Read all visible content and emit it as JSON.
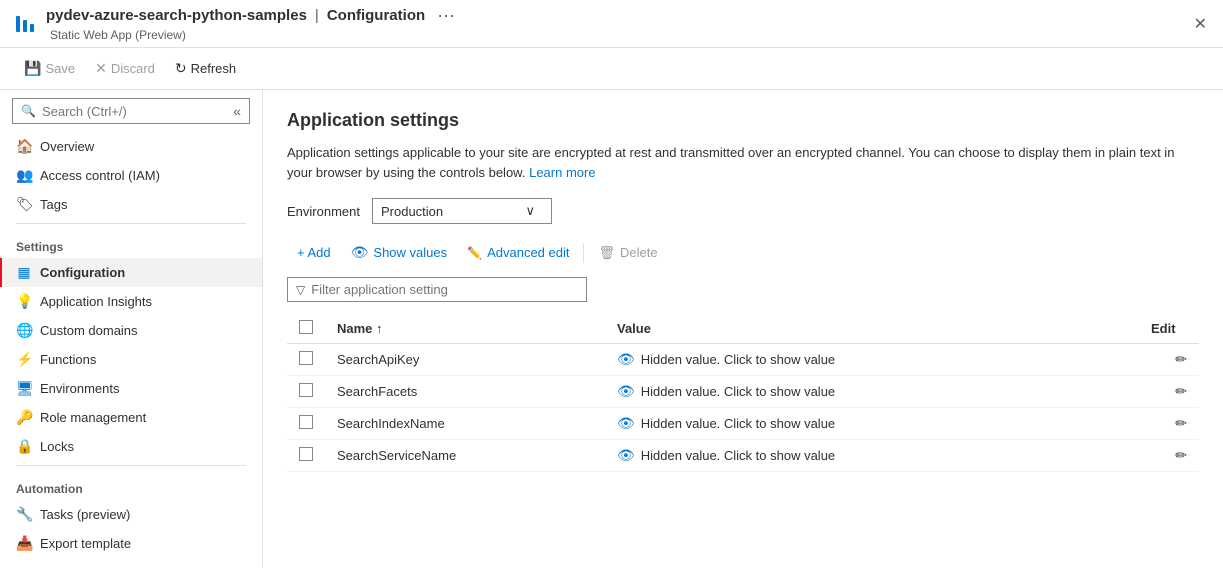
{
  "header": {
    "icon_bars": [
      16,
      12,
      8
    ],
    "app_name": "pydev-azure-search-python-samples",
    "separator": "|",
    "page_title": "Configuration",
    "dots": "···",
    "subtitle": "Static Web App (Preview)",
    "close_label": "✕"
  },
  "toolbar": {
    "save_label": "Save",
    "discard_label": "Discard",
    "refresh_label": "Refresh"
  },
  "sidebar": {
    "search_placeholder": "Search (Ctrl+/)",
    "collapse_icon": "«",
    "nav_items": [
      {
        "id": "overview",
        "label": "Overview",
        "icon": "🏠"
      },
      {
        "id": "access-control",
        "label": "Access control (IAM)",
        "icon": "👥"
      },
      {
        "id": "tags",
        "label": "Tags",
        "icon": "🏷"
      }
    ],
    "settings_section": "Settings",
    "settings_items": [
      {
        "id": "configuration",
        "label": "Configuration",
        "icon": "▦",
        "active": true
      },
      {
        "id": "application-insights",
        "label": "Application Insights",
        "icon": "💡"
      },
      {
        "id": "custom-domains",
        "label": "Custom domains",
        "icon": "🌐"
      },
      {
        "id": "functions",
        "label": "Functions",
        "icon": "⚡"
      },
      {
        "id": "environments",
        "label": "Environments",
        "icon": "🖥"
      },
      {
        "id": "role-management",
        "label": "Role management",
        "icon": "🔑"
      },
      {
        "id": "locks",
        "label": "Locks",
        "icon": "🔒"
      }
    ],
    "automation_section": "Automation",
    "automation_items": [
      {
        "id": "tasks",
        "label": "Tasks (preview)",
        "icon": "🔧"
      },
      {
        "id": "export-template",
        "label": "Export template",
        "icon": "📥"
      }
    ]
  },
  "content": {
    "page_title": "Application settings",
    "description": "Application settings applicable to your site are encrypted at rest and transmitted over an encrypted channel. You can choose to display them in plain text in your browser by using the controls below.",
    "learn_more": "Learn more",
    "env_label": "Environment",
    "env_value": "Production",
    "env_chevron": "∨",
    "actions": {
      "add_label": "+ Add",
      "show_values_label": "Show values",
      "advanced_edit_label": "Advanced edit",
      "delete_label": "Delete"
    },
    "filter_placeholder": "Filter application setting",
    "table": {
      "col_name": "Name",
      "col_sort": "↑",
      "col_value": "Value",
      "col_edit": "Edit",
      "rows": [
        {
          "name": "SearchApiKey",
          "value": "Hidden value. Click to show value"
        },
        {
          "name": "SearchFacets",
          "value": "Hidden value. Click to show value"
        },
        {
          "name": "SearchIndexName",
          "value": "Hidden value. Click to show value"
        },
        {
          "name": "SearchServiceName",
          "value": "Hidden value. Click to show value"
        }
      ]
    }
  }
}
